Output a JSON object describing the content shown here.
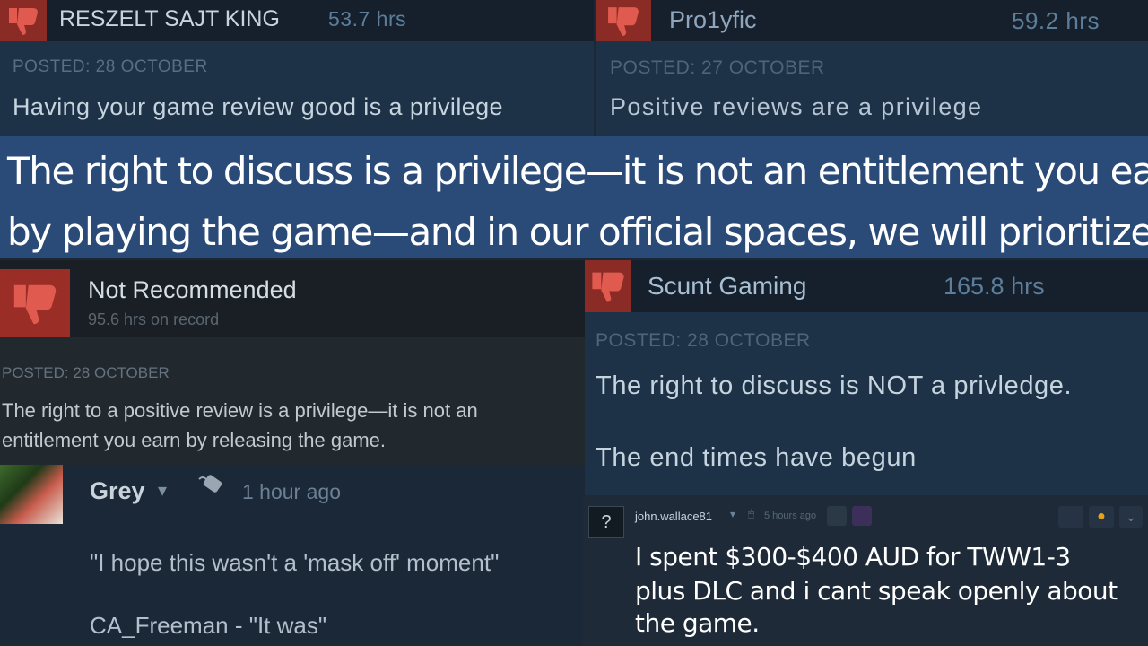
{
  "review_top_left": {
    "username": "RESZELT SAJT KING",
    "hours": "53.7 hrs",
    "posted": "POSTED: 28 OCTOBER",
    "text": "Having your game review good is a privilege"
  },
  "review_top_right": {
    "username": "Pro1yfic",
    "hours": "59.2 hrs",
    "posted": "POSTED: 27 OCTOBER",
    "text": "Positive reviews are a privilege"
  },
  "quote": {
    "line1": "The right to discuss is a privilege—it is not an entitlement you earn",
    "line2": "by playing the game—and in our official spaces, we will prioritize"
  },
  "review_mid_left": {
    "verdict": "Not Recommended",
    "hours_on_record": "95.6 hrs on record",
    "posted": "POSTED: 28 OCTOBER",
    "text_line1": "The right to a positive review is a privilege—it is not an",
    "text_line2": "entitlement you earn by releasing the game."
  },
  "review_mid_right": {
    "username": "Scunt Gaming",
    "hours": "165.8 hrs",
    "posted": "POSTED: 28 OCTOBER",
    "text_line1": "The right to discuss is NOT a privledge.",
    "text_line2": "The end times have begun"
  },
  "comment_grey": {
    "username": "Grey",
    "time": "1 hour ago",
    "line1": "\"I hope this wasn't a 'mask off' moment\"",
    "line2": "CA_Freeman - \"It was\""
  },
  "comment_john": {
    "avatar_glyph": "?",
    "username": "john.wallace81",
    "time": "5 hours ago",
    "line1": "I spent $300-$400 AUD for TWW1-3",
    "line2": "plus DLC and i cant speak openly about",
    "line3": "the game."
  },
  "colors": {
    "thumb_red": "#8b2b25",
    "blue_header": "#16202d",
    "banner": "#2a4a78",
    "text_light": "#c6d4df",
    "muted": "#56707f"
  },
  "icons": [
    "thumbs-down-icon",
    "chevron-down-icon",
    "mouse-icon",
    "gold-award-icon",
    "flag-icon"
  ]
}
